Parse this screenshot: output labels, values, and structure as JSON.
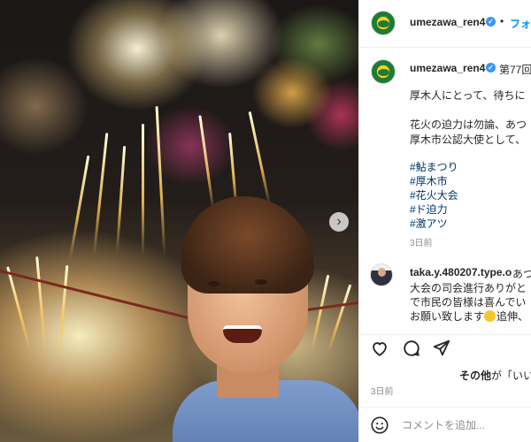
{
  "post": {
    "username": "umezawa_ren4",
    "follow_label": "フォロ",
    "dot": "•",
    "verified_mark": "✓",
    "next_icon": "chevron-right-icon"
  },
  "caption": {
    "title_fragment": "第77回",
    "lines": [
      "厚木人にとって、待ちに",
      "花火の迫力は勿論、あつ",
      "厚木市公認大使として、"
    ],
    "hashtags": [
      "#鮎まつり",
      "#厚木市",
      "#花火大会",
      "#ド迫力",
      "#激アツ"
    ],
    "time": "3日前"
  },
  "comment": {
    "username": "taka.y.480207.type.o",
    "username_suffix": "あつ",
    "lines": [
      "大会の司会進行ありがと",
      "で市民の皆様は喜んでい"
    ],
    "last_line_start": "お願い致します",
    "last_line_end": "追伸、"
  },
  "actions": {
    "like_icon": "heart-icon",
    "comment_icon": "comment-icon",
    "share_icon": "send-icon"
  },
  "likes": {
    "prefix": "その他",
    "text": "が「いい"
  },
  "post_time": "3日前",
  "comment_box": {
    "placeholder": "コメントを追加...",
    "emoji_icon": "smile-icon"
  },
  "colors": {
    "link": "#0095f6",
    "hashtag": "#00376b",
    "muted": "#8e8e8e",
    "verified": "#3897f0"
  }
}
